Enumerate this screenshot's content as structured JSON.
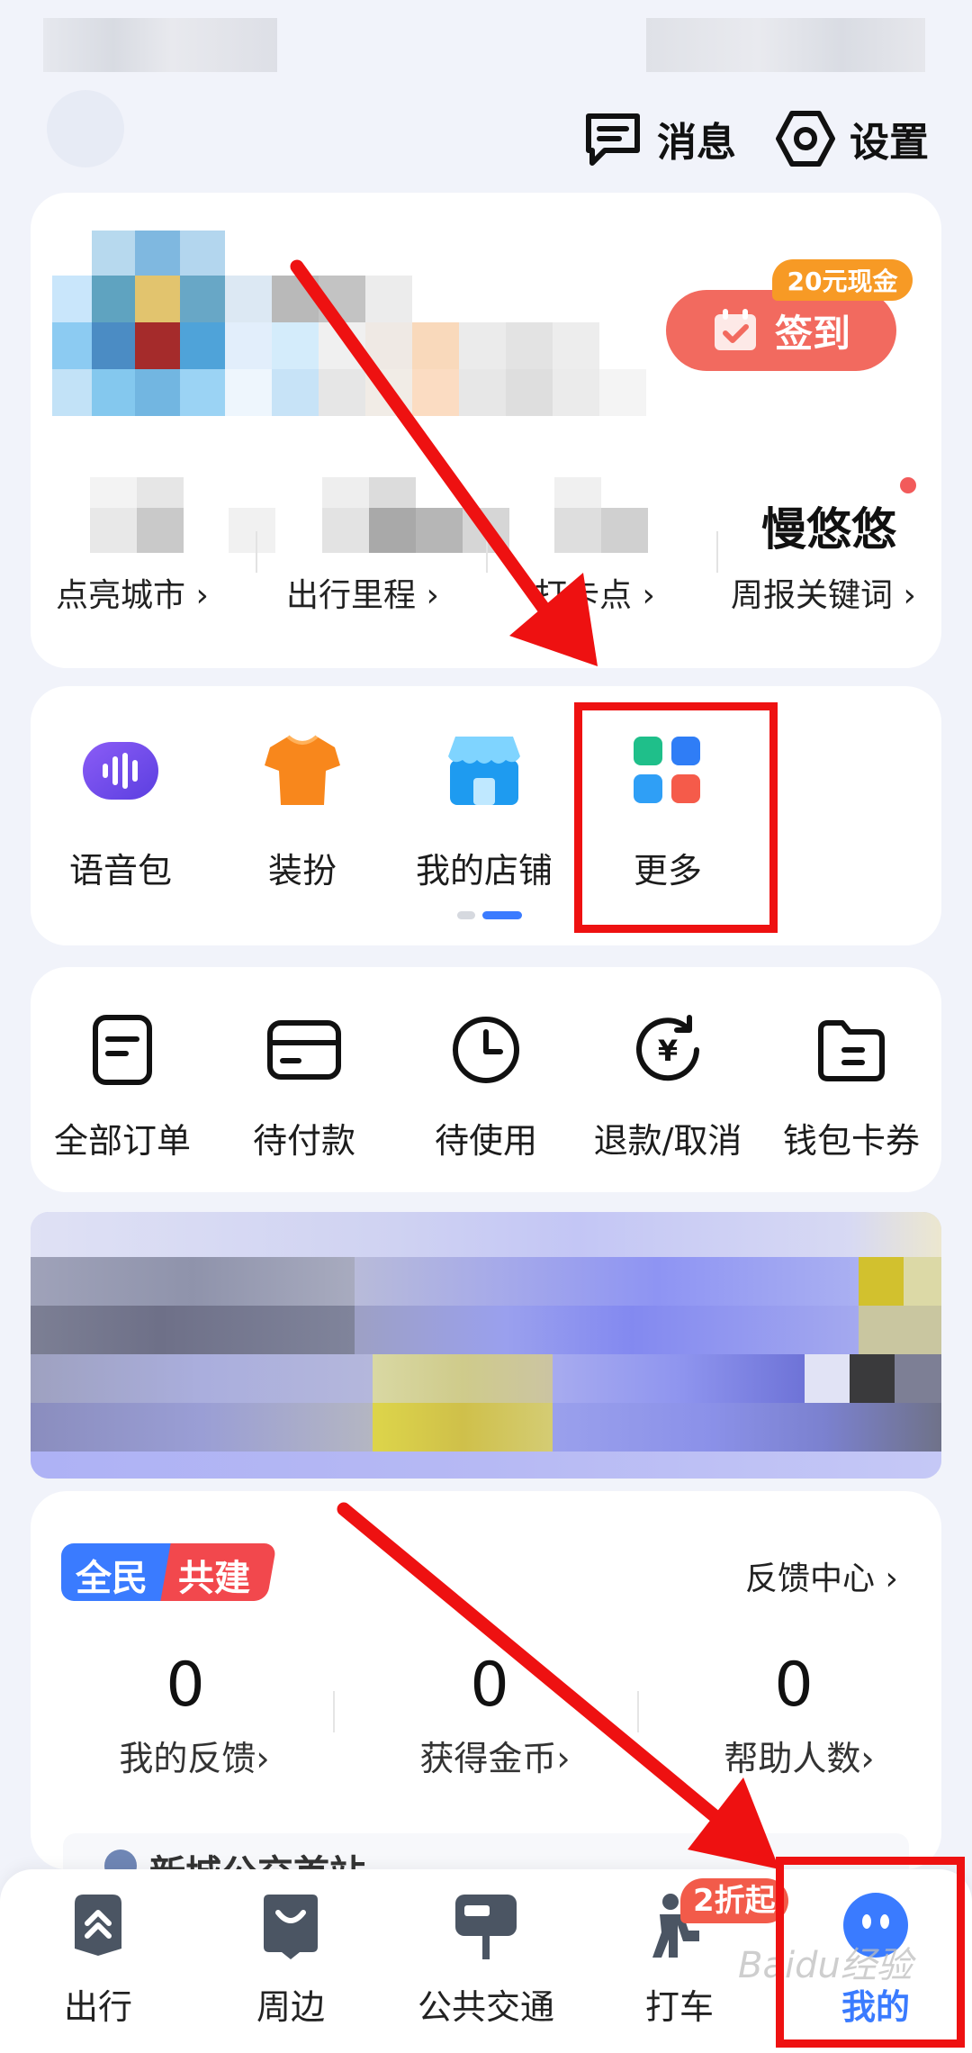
{
  "header": {
    "messages_label": "消息",
    "settings_label": "设置"
  },
  "profile": {
    "checkin_label": "签到",
    "checkin_badge": "20元现金",
    "nickname": "慢悠悠",
    "stats": [
      "点亮城市",
      "出行里程",
      "打卡点",
      "周报关键词"
    ]
  },
  "tools": {
    "items": [
      {
        "label": "语音包",
        "icon": "voice-pack-icon"
      },
      {
        "label": "装扮",
        "icon": "tshirt-icon"
      },
      {
        "label": "我的店铺",
        "icon": "shop-icon"
      },
      {
        "label": "更多",
        "icon": "grid-more-icon"
      }
    ]
  },
  "orders": {
    "items": [
      {
        "label": "全部订单",
        "icon": "order-list-icon"
      },
      {
        "label": "待付款",
        "icon": "card-icon"
      },
      {
        "label": "待使用",
        "icon": "clock-icon"
      },
      {
        "label": "退款/取消",
        "icon": "refund-icon"
      },
      {
        "label": "钱包卡券",
        "icon": "wallet-icon"
      }
    ]
  },
  "feedback": {
    "badge_left": "全民",
    "badge_right": "共建",
    "center_link": "反馈中心",
    "stats": [
      {
        "value": "0",
        "label": "我的反馈"
      },
      {
        "value": "0",
        "label": "获得金币"
      },
      {
        "value": "0",
        "label": "帮助人数"
      }
    ],
    "peek_text": "新城公交首站"
  },
  "tabbar": {
    "items": [
      {
        "label": "出行"
      },
      {
        "label": "周边"
      },
      {
        "label": "公共交通"
      },
      {
        "label": "打车",
        "badge": "2折起"
      },
      {
        "label": "我的"
      }
    ]
  },
  "watermark": "Baidu经验",
  "colors": {
    "accent_blue": "#3a7bff",
    "checkin_red": "#f26a5f",
    "badge_orange": "#f79a25",
    "annotation_red": "#ee1111"
  }
}
